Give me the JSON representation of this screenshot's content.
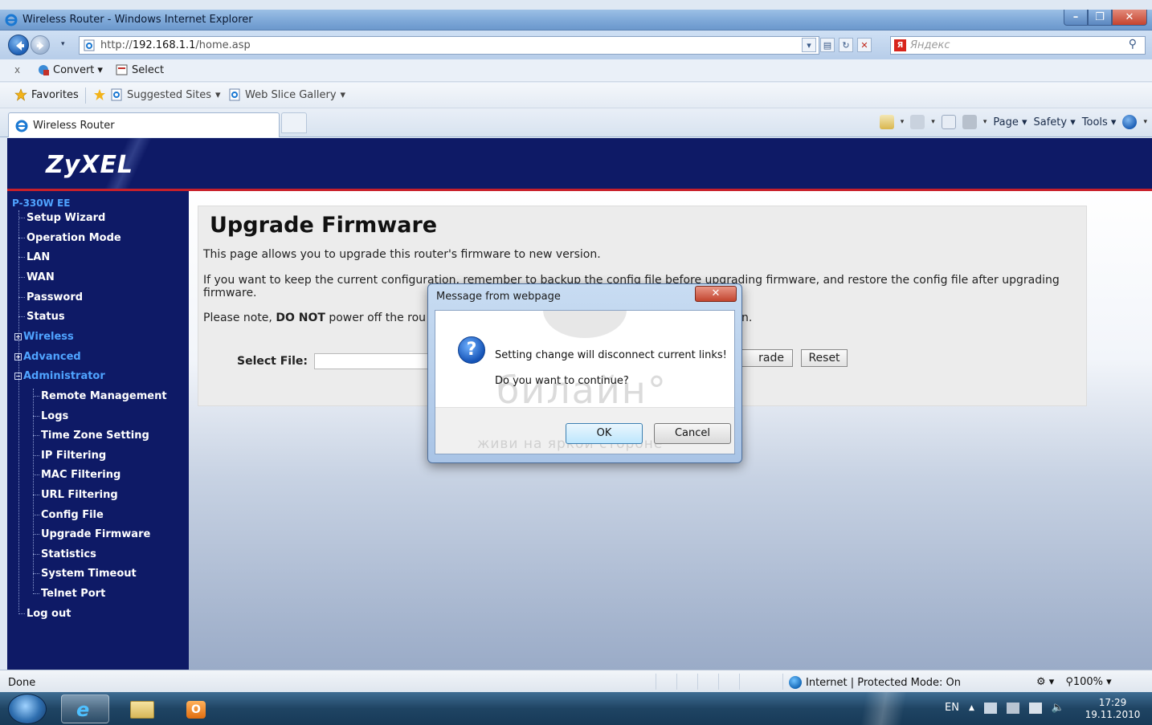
{
  "window": {
    "title": "Wireless Router - Windows Internet Explorer",
    "controls": [
      "–",
      "❐",
      "✕"
    ]
  },
  "address": {
    "url_prefix": "http://",
    "url_host": "192.168.1.1",
    "url_path": "/home.asp"
  },
  "search": {
    "placeholder": "Яндекс",
    "engine_icon": "Я"
  },
  "commandbar": {
    "close_glyph": "x",
    "convert_label": "Convert",
    "select_label": "Select",
    "dropdown_glyph": "▾"
  },
  "favorites": {
    "favorites_label": "Favorites",
    "suggested_label": "Suggested Sites",
    "webslice_label": "Web Slice Gallery"
  },
  "tab": {
    "label": "Wireless Router"
  },
  "tab_commands": {
    "page": "Page",
    "safety": "Safety",
    "tools": "Tools"
  },
  "router": {
    "brand": "ZyXEL",
    "model": "P-330W EE",
    "menu": [
      {
        "label": "Setup Wizard"
      },
      {
        "label": "Operation Mode"
      },
      {
        "label": "LAN"
      },
      {
        "label": "WAN"
      },
      {
        "label": "Password"
      },
      {
        "label": "Status"
      },
      {
        "label": "Wireless"
      },
      {
        "label": "Advanced"
      },
      {
        "label": "Administrator"
      },
      {
        "label": "Remote Management"
      },
      {
        "label": "Logs"
      },
      {
        "label": "Time Zone Setting"
      },
      {
        "label": "IP Filtering"
      },
      {
        "label": "MAC Filtering"
      },
      {
        "label": "URL Filtering"
      },
      {
        "label": "Config File"
      },
      {
        "label": "Upgrade Firmware"
      },
      {
        "label": "Statistics"
      },
      {
        "label": "System Timeout"
      },
      {
        "label": "Telnet Port"
      },
      {
        "label": "Log out"
      }
    ]
  },
  "page": {
    "title": "Upgrade Firmware",
    "description": "This page allows you to upgrade this router's firmware to new version.",
    "note": "If you want to keep the current configuration, remember to backup the config file before upgrading firmware, and restore the config file after upgrading firmware.",
    "warning_prefix": "Please note, ",
    "warning_bold": "DO NOT",
    "warning_suffix": " power off the rou",
    "warning_tail": "n.",
    "select_file_label": "Select File:",
    "upgrade_label": "rade",
    "reset_label": "Reset"
  },
  "dialog": {
    "title": "Message from webpage",
    "message": "Setting change will disconnect current links!",
    "question": "Do you want to continue?",
    "ok_label": "OK",
    "cancel_label": "Cancel",
    "close_glyph": "✕",
    "watermark": "билайн°",
    "watermark_sub": "живи на яркой стороне"
  },
  "statusbar": {
    "status": "Done",
    "zone": "Internet | Protected Mode: On",
    "zoom": "100%"
  },
  "taskbar": {
    "lang": "EN",
    "time": "17:29",
    "date": "19.11.2010"
  }
}
